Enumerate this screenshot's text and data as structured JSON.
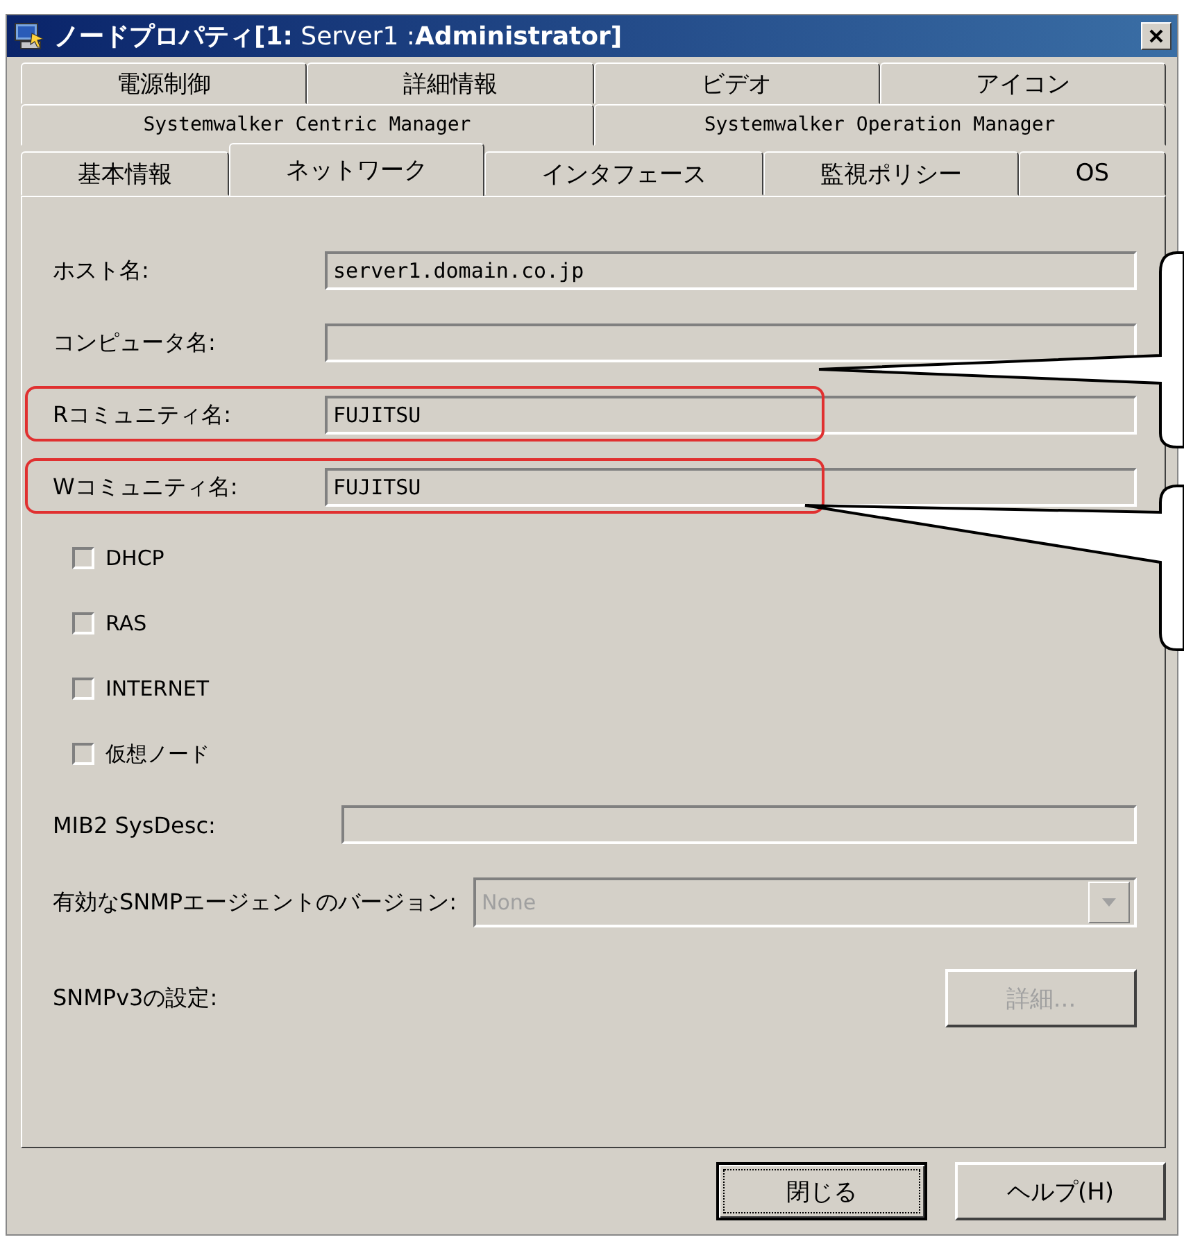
{
  "window": {
    "title": "**ノードプロパティ[1:** Server1 :**Administrator]**"
  },
  "tab_rows": [
    [
      {
        "label": "電源制御",
        "selected": false
      },
      {
        "label": "詳細情報",
        "selected": false
      },
      {
        "label": "ビデオ",
        "selected": false
      },
      {
        "label": "アイコン",
        "selected": false
      }
    ],
    [
      {
        "label": "Systemwalker Centric Manager",
        "selected": false
      },
      {
        "label": "Systemwalker Operation Manager",
        "selected": false
      }
    ],
    [
      {
        "label": "基本情報",
        "selected": false
      },
      {
        "label": "ネットワーク",
        "selected": true
      },
      {
        "label": "インタフェース",
        "selected": false
      },
      {
        "label": "監視ポリシー",
        "selected": false
      },
      {
        "label": "OS",
        "selected": false
      }
    ]
  ],
  "fields": [
    {
      "label": "ホスト名:",
      "value": "server1.domain.co.jp",
      "highlighted": false
    },
    {
      "label": "コンピュータ名:",
      "highlighted": false
    },
    {
      "label": "Rコミュニティ名:",
      "value": "FUJITSU",
      "highlighted": true
    },
    {
      "label": "Wコミュニティ名:",
      "value": "FUJITSU",
      "highlighted": true
    }
  ],
  "checkboxes": [
    {
      "label": "DHCP",
      "checked": false
    },
    {
      "label": "RAS",
      "checked": false
    },
    {
      "label": "INTERNET",
      "checked": false
    },
    {
      "label": "仮想ノード",
      "checked": false
    }
  ],
  "mib2": {
    "label": "MIB2 SysDesc:"
  },
  "snmp_version": {
    "label": "有効なSNMPエージェントのバージョン:",
    "value": "None",
    "disabled": true
  },
  "snmpv3": {
    "label": "SNMPv3の設定:",
    "button": {
      "label": "詳細...",
      "disabled": true
    }
  },
  "buttons": [
    {
      "label": "閉じる",
      "default": true
    },
    {
      "label": "ヘルプ(H)",
      "default": false
    }
  ]
}
